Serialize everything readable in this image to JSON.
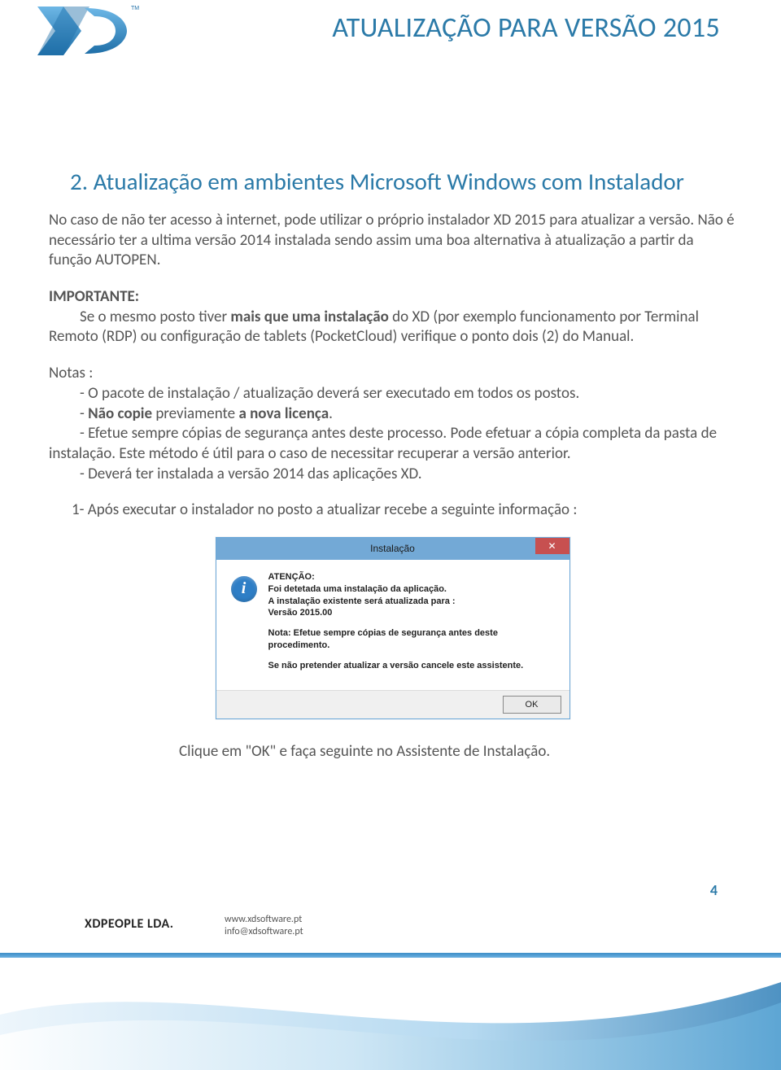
{
  "header": {
    "title": "ATUALIZAÇÃO PARA VERSÃO 2015",
    "logo_tm": "TM"
  },
  "section": {
    "heading": "2. Atualização em ambientes Microsoft Windows com Instalador",
    "para1": "No caso de não ter acesso à internet, pode utilizar o próprio instalador XD 2015 para atualizar a versão. Não é necessário ter a ultima versão 2014 instalada sendo assim uma boa alternativa à atualização a partir da função AUTOPEN.",
    "important_label": "IMPORTANTE:",
    "important_text_a": "Se o mesmo posto tiver ",
    "important_text_bold": "mais que uma instalação",
    "important_text_b": " do XD (por exemplo funcionamento por Terminal Remoto (RDP) ou configuração de tablets (PocketCloud) verifique o ponto dois  (2) do Manual.",
    "notes_label": "Notas :",
    "note1": "- O pacote de instalação / atualização deverá ser executado em todos os postos.",
    "note2_a": "- ",
    "note2_bold1": "Não copie",
    "note2_b": " previamente ",
    "note2_bold2": "a nova licença",
    "note2_c": ".",
    "note3": "- Efetue sempre cópias de segurança antes deste processo. Pode efetuar a cópia completa da pasta de instalação. Este método é útil para o caso de necessitar recuperar a versão anterior.",
    "note4": "- Deverá ter instalada a versão 2014 das aplicações XD.",
    "step1": "1-   Após executar o instalador no posto a atualizar recebe a seguinte informação :",
    "closing": "Clique em \"OK\" e faça seguinte no Assistente de Instalação."
  },
  "dialog": {
    "title": "Instalação",
    "close_x": "✕",
    "info_glyph": "i",
    "line_attention": "ATENÇÃO:",
    "line1": "Foi detetada uma instalação da aplicação.",
    "line2": "A instalação existente será atualizada para :",
    "line3": "Versão 2015.00",
    "line4": "Nota: Efetue sempre cópias de segurança antes deste procedimento.",
    "line5": "Se não pretender atualizar a versão cancele este assistente.",
    "ok": "OK"
  },
  "footer": {
    "page_number": "4",
    "company": "XDPEOPLE LDA.",
    "website": "www.xdsoftware.pt",
    "email": "info@xdsoftware.pt"
  }
}
